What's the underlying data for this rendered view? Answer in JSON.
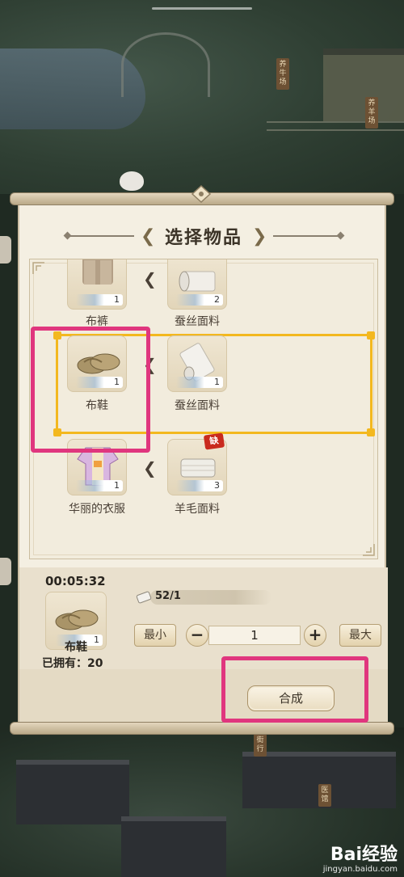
{
  "dialog": {
    "title": "选择物品"
  },
  "recipes": [
    {
      "product": {
        "name": "布裤",
        "qty": "1"
      },
      "material": {
        "name": "蚕丝面料",
        "qty": "2"
      }
    },
    {
      "product": {
        "name": "布鞋",
        "qty": "1"
      },
      "material": {
        "name": "蚕丝面料",
        "qty": "1"
      },
      "selected": true
    },
    {
      "product": {
        "name": "华丽的衣服",
        "qty": "1"
      },
      "material": {
        "name": "羊毛面料",
        "qty": "3",
        "badge": "缺"
      }
    }
  ],
  "craft": {
    "timer": "00:05:32",
    "item_name": "布鞋",
    "item_qty": "1",
    "owned": "已拥有：20",
    "material_count": "52/1",
    "min_label": "最小",
    "max_label": "最大",
    "minus_symbol": "−",
    "plus_symbol": "+",
    "quantity": "1",
    "craft_label": "合成"
  },
  "background": {
    "signs": [
      "养牛场",
      "养羊场",
      "医馆",
      "街行"
    ]
  },
  "watermark": {
    "main": "Bai经验",
    "sub": "jingyan.baidu.com"
  },
  "colors": {
    "highlight": "#e0367e",
    "selection": "#f3b81f",
    "panel": "#f4efe2"
  }
}
